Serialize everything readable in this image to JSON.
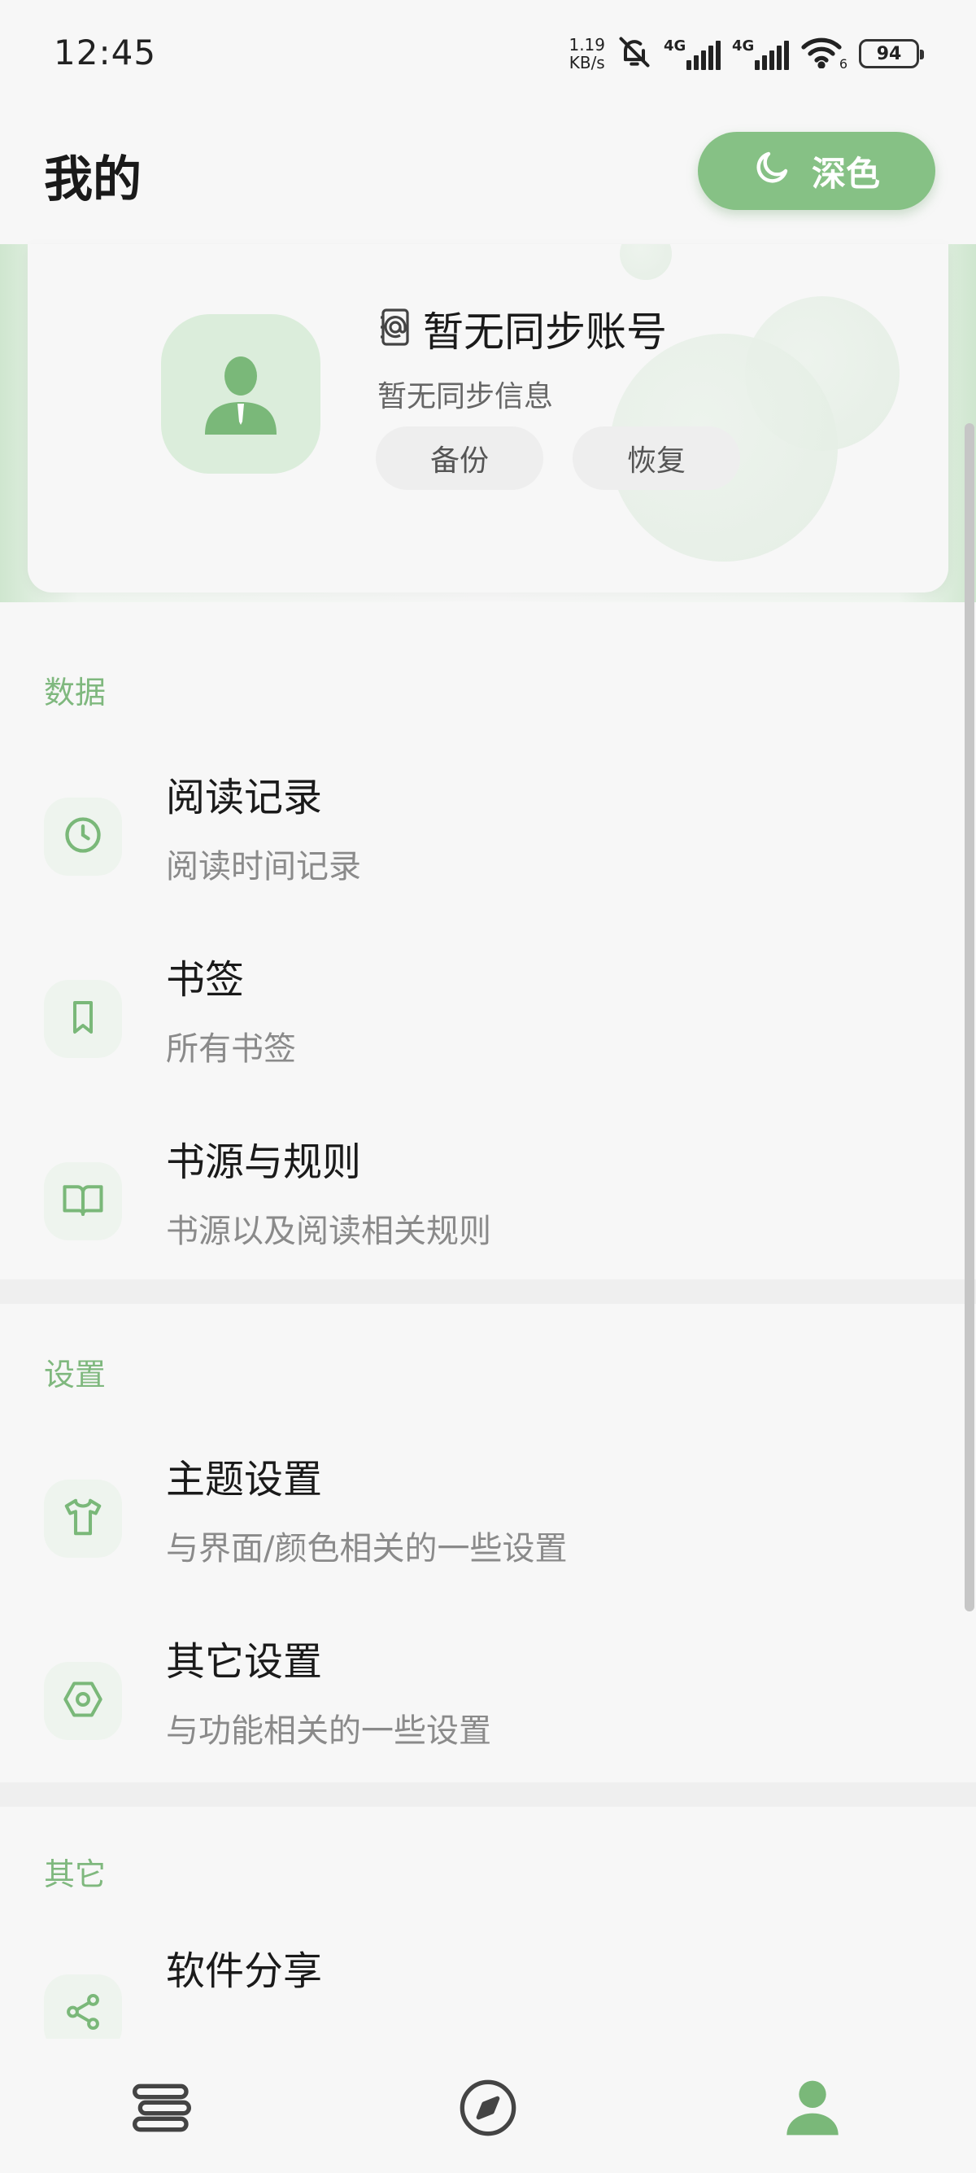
{
  "status_bar": {
    "time": "12:45",
    "net_speed_value": "1.19",
    "net_speed_unit": "KB/s",
    "signal_1_label": "4G",
    "signal_2_label": "4G",
    "wifi_sub": "6",
    "battery": "94"
  },
  "header": {
    "title": "我的",
    "dark_mode_label": "深色"
  },
  "profile": {
    "account_name": "暂无同步账号",
    "account_info": "暂无同步信息",
    "backup_label": "备份",
    "restore_label": "恢复"
  },
  "sections": {
    "data": {
      "header": "数据",
      "items": [
        {
          "title": "阅读记录",
          "subtitle": "阅读时间记录",
          "icon": "clock-icon"
        },
        {
          "title": "书签",
          "subtitle": "所有书签",
          "icon": "bookmark-icon"
        },
        {
          "title": "书源与规则",
          "subtitle": "书源以及阅读相关规则",
          "icon": "open-book-icon"
        }
      ]
    },
    "settings": {
      "header": "设置",
      "items": [
        {
          "title": "主题设置",
          "subtitle": "与界面/颜色相关的一些设置",
          "icon": "tshirt-icon"
        },
        {
          "title": "其它设置",
          "subtitle": "与功能相关的一些设置",
          "icon": "hex-nut-icon"
        }
      ]
    },
    "other": {
      "header": "其它",
      "items": [
        {
          "title": "软件分享",
          "icon": "share-icon"
        }
      ]
    }
  },
  "bottom_nav": {
    "items": [
      {
        "icon": "bookshelf-icon",
        "active": false
      },
      {
        "icon": "compass-icon",
        "active": false
      },
      {
        "icon": "person-icon",
        "active": true
      }
    ]
  },
  "colors": {
    "accent": "#86c185",
    "section_header": "#7fb87e",
    "icon": "#7ab879"
  }
}
